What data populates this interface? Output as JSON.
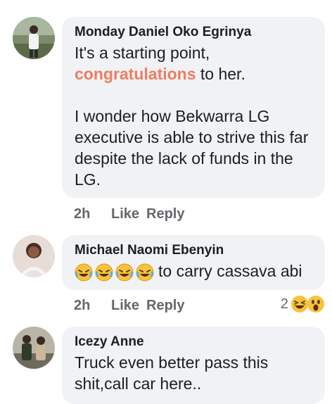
{
  "comments": [
    {
      "author": "Monday Daniel Oko Egrinya",
      "text_before": "It's a starting point,",
      "highlight": "congratulations",
      "text_after": " to her.",
      "paragraph2": "I wonder how Bekwarra LG executive is able to strive this far despite the lack of funds in the LG.",
      "time": "2h",
      "like": "Like",
      "reply": "Reply"
    },
    {
      "author": "Michael Naomi Ebenyin",
      "emojis": [
        "rolling-laughing-icon",
        "rolling-laughing-icon",
        "rolling-laughing-icon",
        "rolling-laughing-icon"
      ],
      "text": "to carry cassava abi",
      "time": "2h",
      "like": "Like",
      "reply": "Reply",
      "reaction_count": "2",
      "reaction_icons": [
        "haha-reaction-icon",
        "wow-reaction-icon"
      ]
    },
    {
      "author": "Icezy Anne",
      "text": "Truck even better pass this shit,call car here.."
    }
  ],
  "colors": {
    "bubble": "#f0f2f5",
    "highlight": "#ee7d5f",
    "meta": "#65676b",
    "text": "#1c1e21"
  }
}
